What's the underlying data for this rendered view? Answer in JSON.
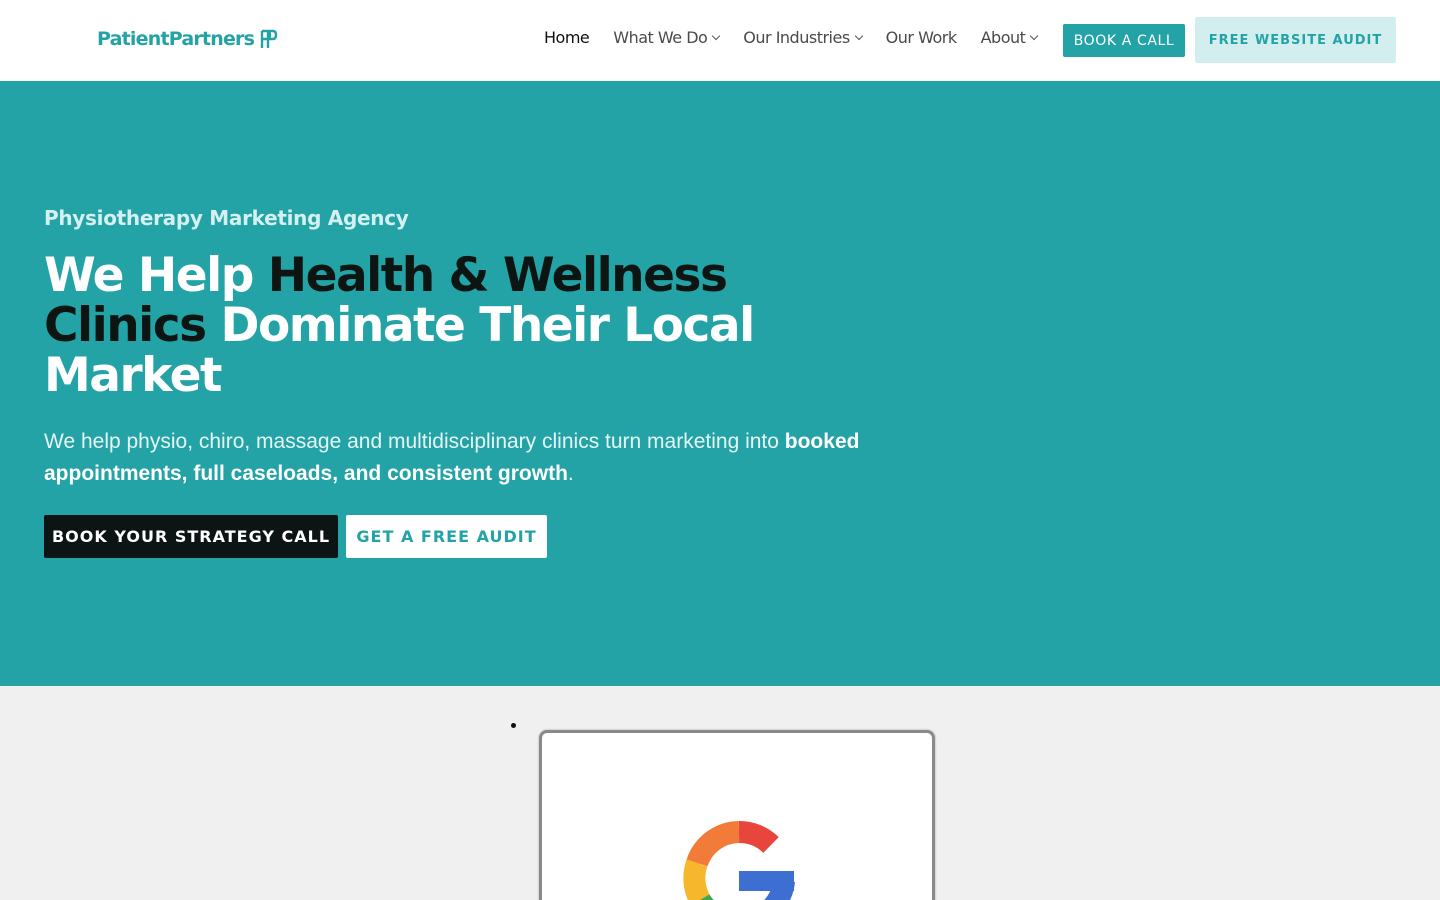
{
  "header": {
    "logo_text": "PatientPartners",
    "nav": [
      {
        "label": "Home",
        "has_dropdown": false,
        "active": true
      },
      {
        "label": "What We Do",
        "has_dropdown": true
      },
      {
        "label": "Our Industries",
        "has_dropdown": true
      },
      {
        "label": "Our Work",
        "has_dropdown": false
      },
      {
        "label": "About",
        "has_dropdown": true
      }
    ],
    "book_call_label": "BOOK A CALL",
    "audit_label": "FREE WEBSITE AUDIT"
  },
  "hero": {
    "eyebrow": "Physiotherapy Marketing Agency",
    "headline": {
      "part1": "We Help ",
      "part2": "Health & Wellness Clinics",
      "part3": " Dominate Their Local Market"
    },
    "subtext": {
      "lead": "We help physio, chiro, massage and multidisciplinary clinics turn marketing into ",
      "bold": "booked appointments, full caseloads, and consistent growth",
      "tail": "."
    },
    "primary_cta": "BOOK YOUR STRATEGY CALL",
    "secondary_cta": "GET A FREE AUDIT"
  },
  "colors": {
    "brand_teal": "#23a3a6",
    "dark": "#0c1513",
    "light_teal": "#d3eeee",
    "section_bg": "#f0f0f0"
  },
  "icons": {
    "logo_mark": "pp-monogram-icon",
    "review_card": "google-g-icon"
  }
}
